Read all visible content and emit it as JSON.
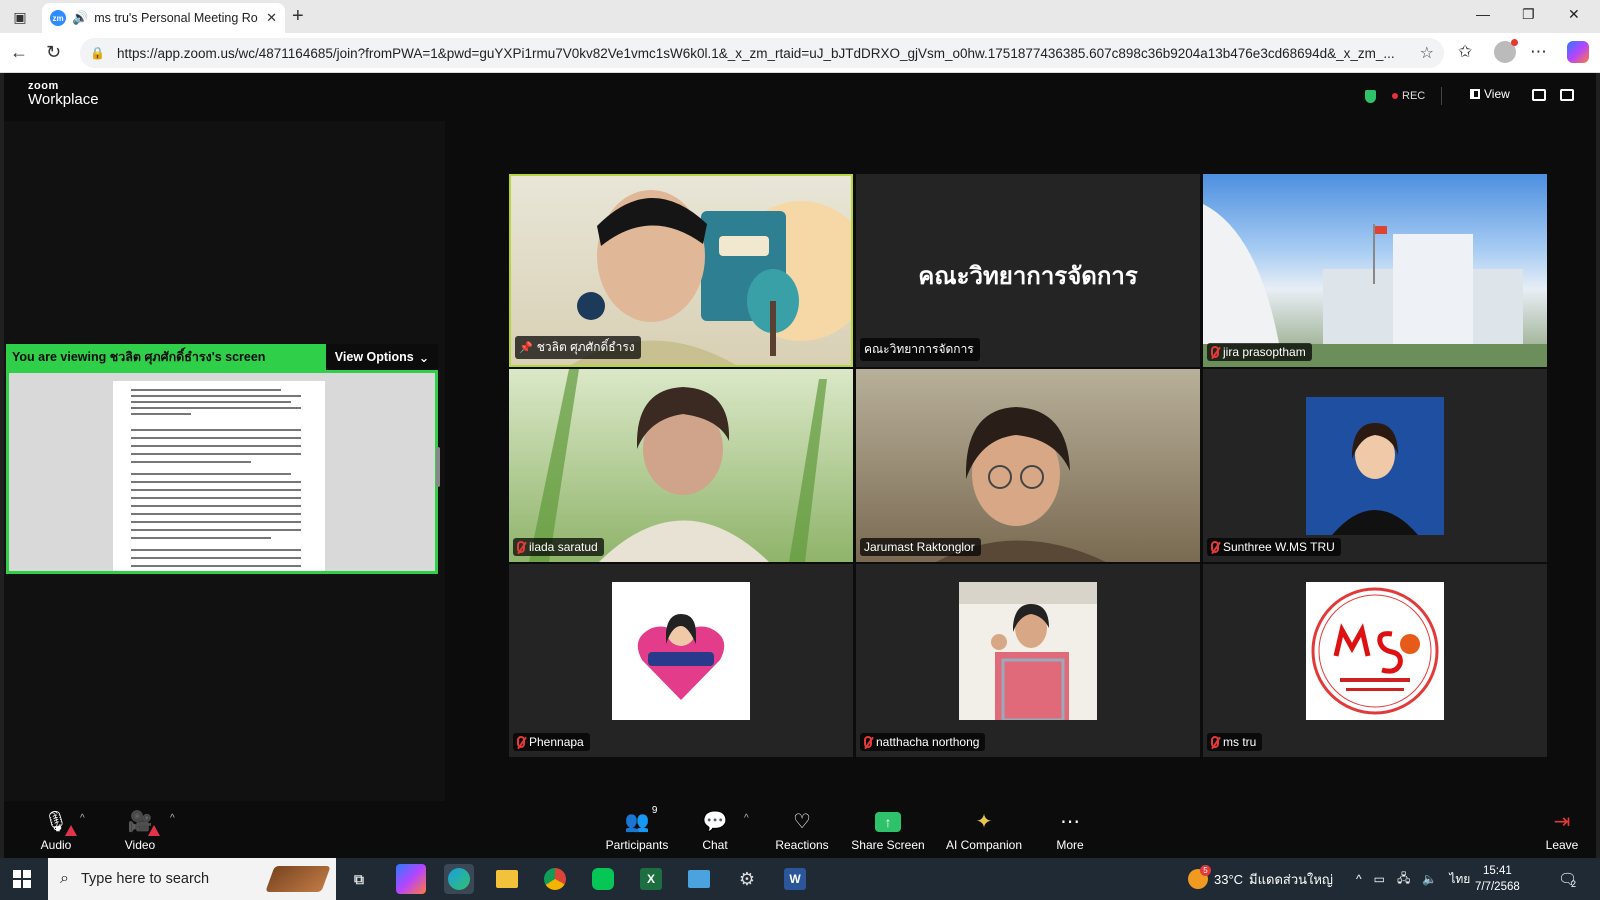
{
  "browser": {
    "tab_title": "ms tru's Personal Meeting Ro",
    "url": "https://app.zoom.us/wc/4871164685/join?fromPWA=1&pwd=guYXPi1rmu7V0kv82Ve1vmc1sW6k0l.1&_x_zm_rtaid=uJ_bJTdDRXO_gjVsm_o0hw.1751877436385.607c898c36b9204a13b476e3cd68694d&_x_zm_..."
  },
  "zoom": {
    "logo_small": "zoom",
    "logo_product": "Workplace",
    "rec_label": "REC",
    "view_label": "View",
    "viewing_text": "You are viewing  ชวลิต ศุภศักดิ์ธำรง's screen",
    "view_options_label": "View Options"
  },
  "participants": [
    {
      "name": "ชวลิต ศุภศักดิ์ธำรง",
      "pinned": true,
      "muted": false
    },
    {
      "name": "คณะวิทยาการจัดการ",
      "display_text": "คณะวิทยาการจัดการ",
      "muted": false
    },
    {
      "name": "jira prasoptham",
      "muted": true
    },
    {
      "name": "ilada saratud",
      "muted": true
    },
    {
      "name": "Jarumast Raktonglor",
      "muted": false
    },
    {
      "name": "Sunthree W.MS TRU",
      "muted": true
    },
    {
      "name": "Phennapa",
      "muted": true
    },
    {
      "name": "natthacha northong",
      "muted": true
    },
    {
      "name": "ms tru",
      "muted": true
    }
  ],
  "toolbar": {
    "audio": "Audio",
    "video": "Video",
    "participants": "Participants",
    "participants_count": "9",
    "chat": "Chat",
    "reactions": "Reactions",
    "share_screen": "Share Screen",
    "ai_companion": "AI Companion",
    "more": "More",
    "leave": "Leave"
  },
  "taskbar": {
    "search_placeholder": "Type here to search",
    "weather_temp": "33°C",
    "weather_desc": "มีแดดส่วนใหญ่",
    "lang": "ไทย",
    "time": "15:41",
    "date": "7/7/2568",
    "notif_count": "2",
    "weather_badge": "5"
  },
  "colors": {
    "zoom_green": "#2fcf4a",
    "active_border": "#b6d640",
    "rec_red": "#e5323e",
    "zoom_blue": "#2d8cff"
  }
}
